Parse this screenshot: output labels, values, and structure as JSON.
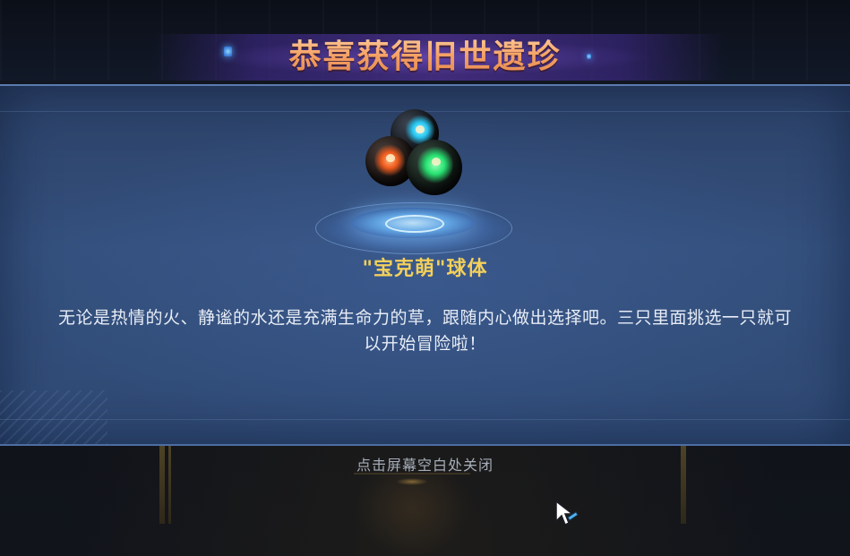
{
  "dialog": {
    "title": "恭喜获得旧世遗珍",
    "item_name": "\"宝克萌\"球体",
    "description": "无论是热情的火、静谧的水还是充满生命力的草，跟随内心做出选择吧。三只里面挑选一只就可以开始冒险啦！",
    "close_hint": "点击屏幕空白处关闭"
  },
  "reward_item": {
    "icon": "capture-orbs-icon",
    "orbs": [
      {
        "element": "water",
        "color": "#28c6f2"
      },
      {
        "element": "fire",
        "color": "#ee5a1c"
      },
      {
        "element": "grass",
        "color": "#27e372"
      }
    ]
  },
  "colors": {
    "title_gradient_top": "#ffd7a8",
    "title_gradient_bottom": "#e58a4f",
    "item_name": "#f3d05a",
    "panel": "#34507d",
    "hint_text": "#a6adb9"
  }
}
